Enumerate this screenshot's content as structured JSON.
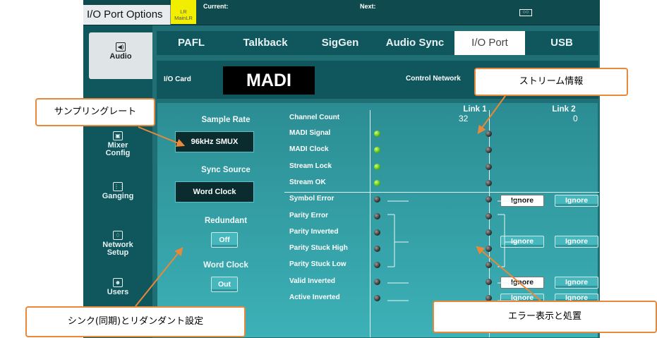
{
  "topbar": {
    "app_title": "I/O Port Options",
    "lr_badge": [
      "LR",
      "MainLR"
    ],
    "current_label": "Current:",
    "next_label": "Next:",
    "icon": "scene-icon"
  },
  "sidebar": {
    "items": [
      {
        "label": "Audio",
        "icon": "speaker-icon",
        "active": true
      },
      {
        "label": "Mixer\nConfig",
        "icon": "mixer-config-icon"
      },
      {
        "label": "Ganging",
        "icon": "grid-icon"
      },
      {
        "label": "Network\nSetup",
        "icon": "network-icon"
      },
      {
        "label": "Users",
        "icon": "users-icon"
      }
    ]
  },
  "tabs": [
    {
      "label": "PAFL"
    },
    {
      "label": "Talkback"
    },
    {
      "label": "SigGen"
    },
    {
      "label": "Audio Sync"
    },
    {
      "label": "I/O Port",
      "active": true
    },
    {
      "label": "USB"
    }
  ],
  "io_card": {
    "label": "I/O Card",
    "value": "MADI",
    "control_network_label": "Control Network"
  },
  "left_panel": {
    "sample_rate_label": "Sample Rate",
    "sample_rate_value": "96kHz SMUX",
    "sync_source_label": "Sync Source",
    "sync_source_value": "Word Clock",
    "redundant_label": "Redundant",
    "redundant_value": "Off",
    "word_clock_label": "Word Clock",
    "word_clock_value": "Out"
  },
  "status": {
    "link1_header": "Link 1",
    "link2_header": "Link 2",
    "channel_count_label": "Channel Count",
    "link1_channel_count": "32",
    "link2_channel_count": "0",
    "rows": [
      {
        "label": "MADI Signal",
        "link1": "green",
        "link2": "dark"
      },
      {
        "label": "MADI Clock",
        "link1": "green",
        "link2": "dark"
      },
      {
        "label": "Stream Lock",
        "link1": "green",
        "link2": "dark"
      },
      {
        "label": "Stream OK",
        "link1": "green",
        "link2": "dark"
      },
      {
        "label": "Symbol Error",
        "link1": "dark",
        "link2": "dark"
      },
      {
        "label": "Parity Error",
        "link1": "dark",
        "link2": "dark"
      },
      {
        "label": "Parity Inverted",
        "link1": "dark",
        "link2": "dark"
      },
      {
        "label": "Parity Stuck High",
        "link1": "dark",
        "link2": "dark"
      },
      {
        "label": "Parity Stuck Low",
        "link1": "dark",
        "link2": "dark"
      },
      {
        "label": "Valid Inverted",
        "link1": "dark",
        "link2": "dark"
      },
      {
        "label": "Active Inverted",
        "link1": "dark",
        "link2": "dark"
      }
    ],
    "ignore_label": "Ignore"
  },
  "annotations": {
    "sample_rate": "サンプリングレート",
    "stream_info": "ストリーム情報",
    "sync_redundant": "シンク(同期)とリダンダント設定",
    "error_display": "エラー表示と処置"
  },
  "colors": {
    "callout_border": "#e8883a",
    "led_green": "#5fc218",
    "led_dark": "#3a3a3a",
    "lr_badge": "#f2ee00"
  }
}
